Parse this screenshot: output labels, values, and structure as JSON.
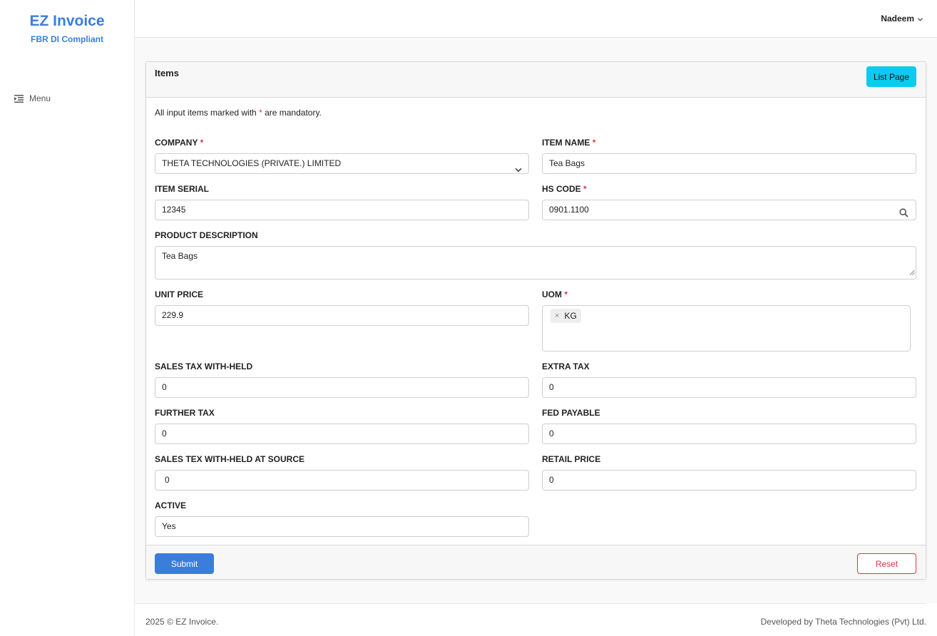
{
  "brand": {
    "title": "EZ Invoice",
    "subtitle": "FBR DI Compliant"
  },
  "sidebar": {
    "menu_label": "Menu",
    "menu_icon": "indent-list-icon"
  },
  "topbar": {
    "user_name": "Nadeem"
  },
  "card": {
    "title": "Items",
    "list_button": "List Page",
    "note_before": "All input items marked with ",
    "note_star": "*",
    "note_after": " are mandatory."
  },
  "form": {
    "required_mark": "*",
    "company": {
      "label": "COMPANY",
      "value": "THETA TECHNOLOGIES (PRIVATE.) LIMITED",
      "required": true
    },
    "item_name": {
      "label": "ITEM NAME",
      "value": "Tea Bags",
      "required": true
    },
    "item_serial": {
      "label": "ITEM SERIAL",
      "value": "12345"
    },
    "hs_code": {
      "label": "HS CODE",
      "value": "0901.1100",
      "required": true
    },
    "product_description": {
      "label": "PRODUCT DESCRIPTION",
      "value": "Tea Bags"
    },
    "unit_price": {
      "label": "UNIT PRICE",
      "value": "229.9"
    },
    "uom": {
      "label": "UOM",
      "tag": "KG",
      "remove": "×",
      "required": true
    },
    "sales_tax_withheld": {
      "label": "SALES TAX WITH-HELD",
      "value": "0"
    },
    "extra_tax": {
      "label": "EXTRA TAX",
      "value": "0"
    },
    "further_tax": {
      "label": "FURTHER TAX",
      "value": "0"
    },
    "fed_payable": {
      "label": "FED PAYABLE",
      "value": "0"
    },
    "sales_tex_withheld_source": {
      "label": "SALES TEX WITH-HELD AT SOURCE",
      "value": "0"
    },
    "retail_price": {
      "label": "RETAIL PRICE",
      "value": "0"
    },
    "active": {
      "label": "ACTIVE",
      "value": "Yes"
    }
  },
  "actions": {
    "submit": "Submit",
    "reset": "Reset"
  },
  "footer": {
    "left": "2025 © EZ Invoice.",
    "right": "Developed by Theta Technologies (Pvt) Ltd."
  },
  "colors": {
    "brand": "#3b7ddd",
    "info_button": "#0dcaf0",
    "danger": "#dc3545",
    "primary": "#3b7ddd"
  }
}
